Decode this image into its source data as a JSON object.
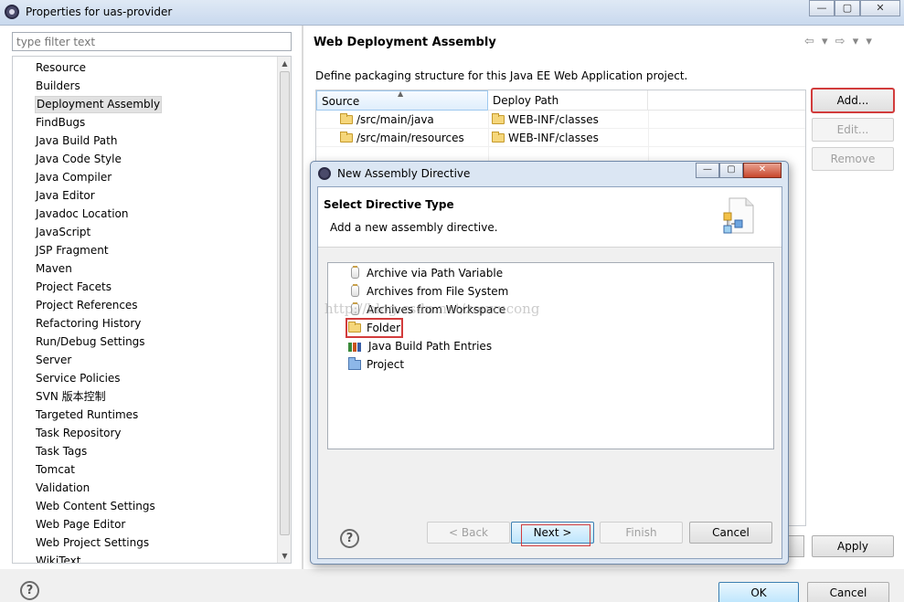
{
  "window": {
    "title": "Properties for uas-provider",
    "minimize": "—",
    "maximize": "▢",
    "close": "✕"
  },
  "left": {
    "filter_placeholder": "type filter text",
    "items": [
      "Resource",
      "Builders",
      "Deployment Assembly",
      "FindBugs",
      "Java Build Path",
      "Java Code Style",
      "Java Compiler",
      "Java Editor",
      "Javadoc Location",
      "JavaScript",
      "JSP Fragment",
      "Maven",
      "Project Facets",
      "Project References",
      "Refactoring History",
      "Run/Debug Settings",
      "Server",
      "Service Policies",
      "SVN 版本控制",
      "Targeted Runtimes",
      "Task Repository",
      "Task Tags",
      "Tomcat",
      "Validation",
      "Web Content Settings",
      "Web Page Editor",
      "Web Project Settings",
      "WikiText"
    ],
    "selected_index": 2
  },
  "page": {
    "title": "Web Deployment Assembly",
    "nav": "⇦ ▾ ⇨ ▾ ▾",
    "description": "Define packaging structure for this Java EE Web Application project.",
    "columns": [
      "Source",
      "Deploy Path"
    ],
    "rows": [
      {
        "source": "/src/main/java",
        "deploy": "WEB-INF/classes"
      },
      {
        "source": "/src/main/resources",
        "deploy": "WEB-INF/classes"
      }
    ],
    "add_label": "Add...",
    "edit_label": "Edit...",
    "remove_label": "Remove",
    "apply_label": "Apply"
  },
  "footer": {
    "help": "?",
    "ok_label": "OK",
    "cancel_label": "Cancel"
  },
  "dialog": {
    "title": "New Assembly Directive",
    "header_title": "Select Directive Type",
    "header_desc": "Add a new assembly directive.",
    "items": [
      {
        "label": "Archive via Path Variable",
        "icon": "jar-icon"
      },
      {
        "label": "Archives from File System",
        "icon": "jar-icon"
      },
      {
        "label": "Archives from Workspace",
        "icon": "jar-icon"
      },
      {
        "label": "Folder",
        "icon": "folder-icon"
      },
      {
        "label": "Java Build Path Entries",
        "icon": "library-icon"
      },
      {
        "label": "Project",
        "icon": "project-icon"
      }
    ],
    "highlighted_index": 3,
    "watermark": "http://blog.csdn.net/zouxucong",
    "help": "?",
    "back_label": "< Back",
    "next_label": "Next >",
    "finish_label": "Finish",
    "cancel_label": "Cancel"
  },
  "colors": {
    "highlight_red": "#d23c3c",
    "default_button_blue": "#bee6fd",
    "selected_row": "#e2e2e2"
  }
}
